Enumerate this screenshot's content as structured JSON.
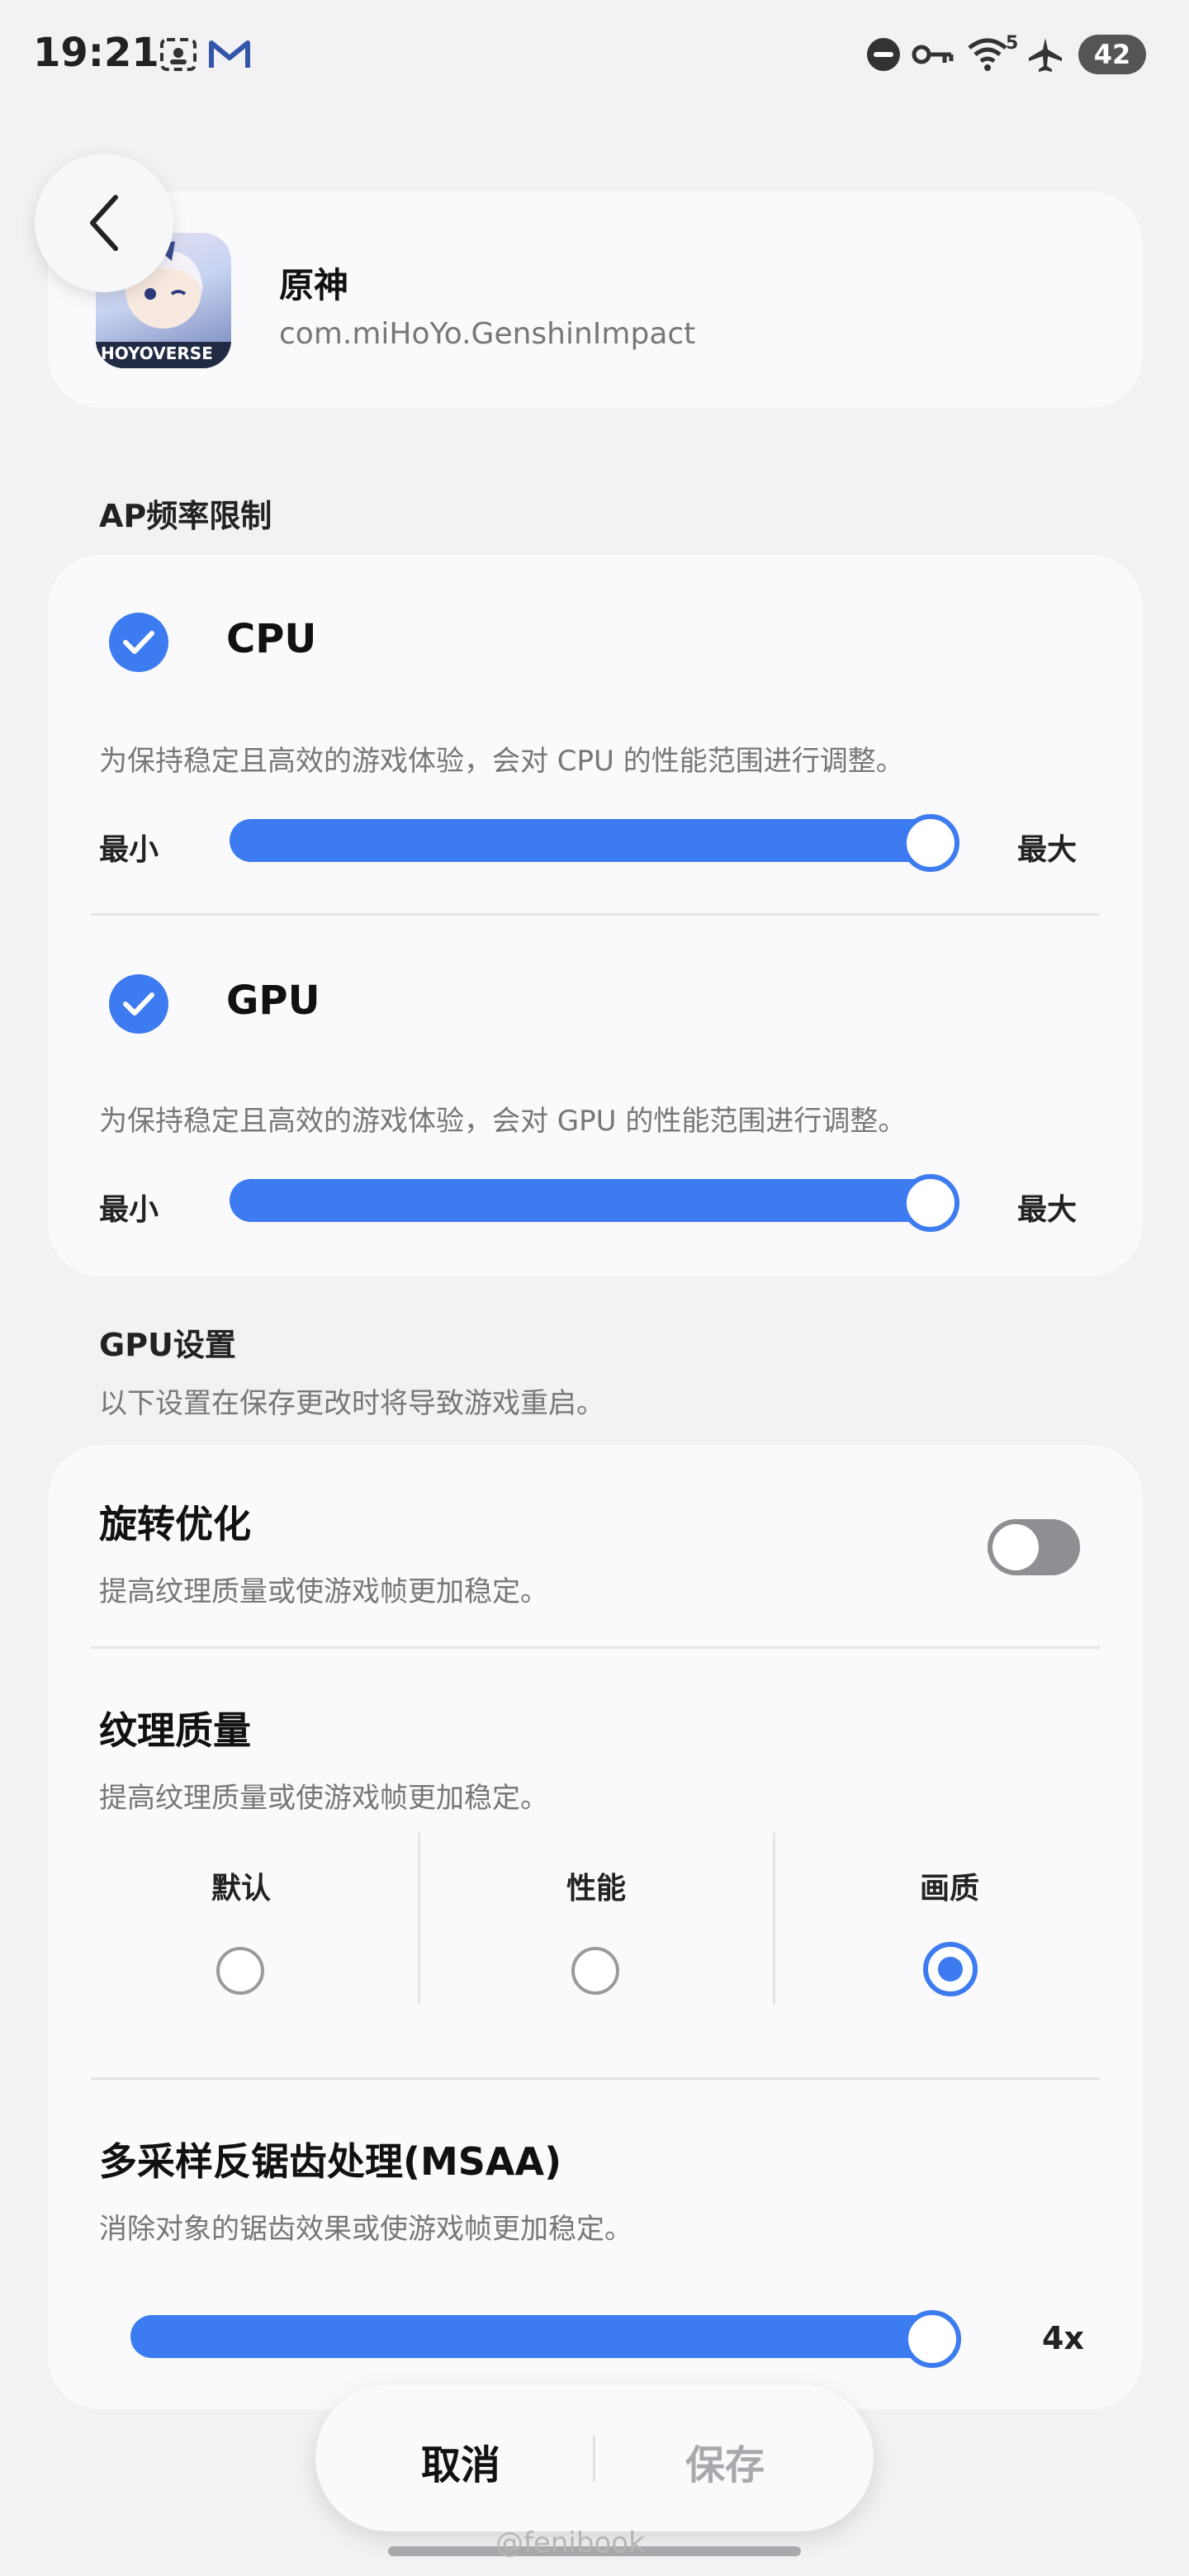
{
  "status_bar": {
    "time": "19:21",
    "wifi_badge": "5",
    "battery": "42",
    "icons": [
      "screenshot-icon",
      "gmail-icon",
      "do-not-disturb-icon",
      "vpn-key-icon",
      "wifi-icon",
      "airplane-icon"
    ]
  },
  "app": {
    "name": "原神",
    "package": "com.miHoYo.GenshinImpact",
    "icon_text": "HOYOVERSE"
  },
  "ap_section": {
    "title": "AP频率限制",
    "cpu": {
      "label": "CPU",
      "checked": true,
      "description": "为保持稳定且高效的游戏体验，会对 CPU 的性能范围进行调整。",
      "min_label": "最小",
      "max_label": "最大",
      "level": 1.0
    },
    "gpu": {
      "label": "GPU",
      "checked": true,
      "description": "为保持稳定且高效的游戏体验，会对 GPU 的性能范围进行调整。",
      "min_label": "最小",
      "max_label": "最大",
      "level": 1.0
    }
  },
  "gpu_section": {
    "title": "GPU设置",
    "subtitle": "以下设置在保存更改时将导致游戏重启。",
    "rotation": {
      "title": "旋转优化",
      "description": "提高纹理质量或使游戏帧更加稳定。",
      "enabled": false
    },
    "texture": {
      "title": "纹理质量",
      "description": "提高纹理质量或使游戏帧更加稳定。",
      "options": [
        "默认",
        "性能",
        "画质"
      ],
      "selected": "画质"
    },
    "msaa": {
      "title": "多采样反锯齿处理(MSAA)",
      "description": "消除对象的锯齿效果或使游戏帧更加稳定。",
      "value_label": "4x",
      "level": 1.0
    }
  },
  "actions": {
    "cancel": "取消",
    "save": "保存"
  },
  "watermark": "@fenibook",
  "colors": {
    "accent": "#3d7bf0",
    "background": "#f2f2f4",
    "card": "#fafafc"
  }
}
